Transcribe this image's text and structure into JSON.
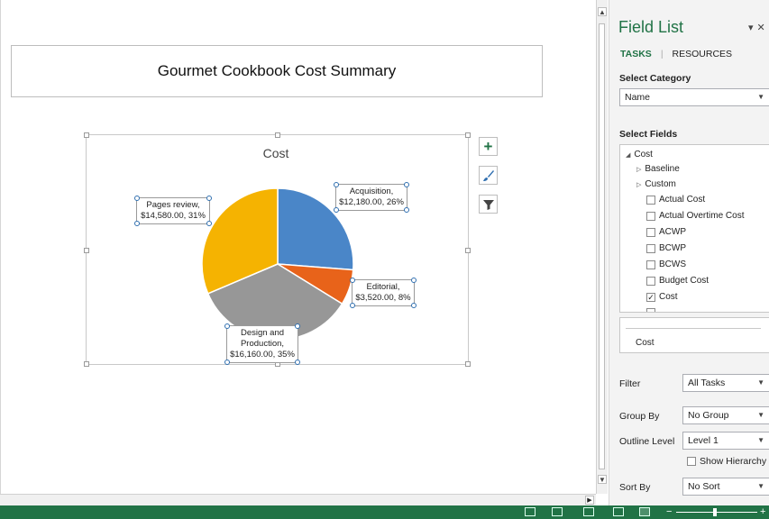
{
  "report": {
    "title": "Gourmet Cookbook Cost Summary"
  },
  "chart_data": {
    "type": "pie",
    "title": "Cost",
    "categories": [
      "Acquisition",
      "Editorial",
      "Design and Production",
      "Pages review"
    ],
    "values": [
      12180.0,
      3520.0,
      16160.0,
      14580.0
    ],
    "percents": [
      26,
      8,
      35,
      31
    ],
    "colors": [
      "#4a86c8",
      "#e8631a",
      "#979797",
      "#f5b301"
    ],
    "labels": [
      {
        "line1": "Acquisition,",
        "line2": "$12,180.00, 26%"
      },
      {
        "line1": "Editorial,",
        "line2": "$3,520.00, 8%"
      },
      {
        "line1": "Design and",
        "line2": "Production,",
        "line3": "$16,160.00, 35%"
      },
      {
        "line1": "Pages review,",
        "line2": "$14,580.00, 31%"
      }
    ]
  },
  "chart_buttons": [
    {
      "icon": "plus-icon",
      "color": "#217346"
    },
    {
      "icon": "brush-icon",
      "color": "#2f6fb0"
    },
    {
      "icon": "filter-icon",
      "color": "#444444"
    }
  ],
  "panel": {
    "title": "Field List",
    "tabs": [
      "TASKS",
      "RESOURCES"
    ],
    "select_category_label": "Select Category",
    "category_value": "Name",
    "select_fields_label": "Select Fields",
    "tree": {
      "root": "Cost",
      "groups": [
        "Baseline",
        "Custom"
      ],
      "fields": [
        {
          "label": "Actual Cost",
          "checked": false
        },
        {
          "label": "Actual Overtime Cost",
          "checked": false
        },
        {
          "label": "ACWP",
          "checked": false
        },
        {
          "label": "BCWP",
          "checked": false
        },
        {
          "label": "BCWS",
          "checked": false
        },
        {
          "label": "Budget Cost",
          "checked": false
        },
        {
          "label": "Cost",
          "checked": true
        }
      ]
    },
    "selected_field": "Cost",
    "filter_label": "Filter",
    "filter_value": "All Tasks",
    "group_by_label": "Group By",
    "group_by_value": "No Group",
    "outline_label": "Outline Level",
    "outline_value": "Level 1",
    "show_hierarchy_label": "Show Hierarchy",
    "sort_by_label": "Sort By",
    "sort_by_value": "No Sort"
  },
  "theme": {
    "accent": "#217346"
  }
}
